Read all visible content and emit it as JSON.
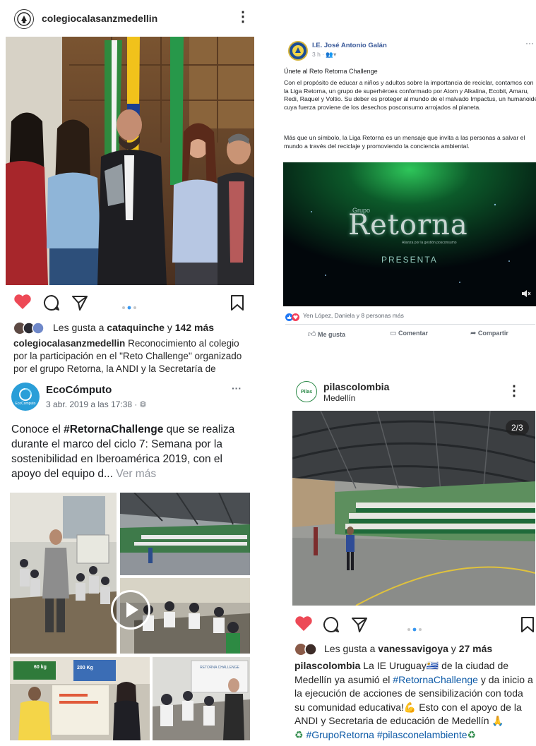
{
  "post1": {
    "username": "colegiocalasanzmedellin",
    "likes_prefix": "Les gusta a ",
    "likes_user": "cataquinche",
    "likes_join": " y ",
    "likes_count": "142 más",
    "caption_user": "colegiocalasanzmedellin",
    "caption_text": " Reconocimiento al colegio por la participación en el \"Reto Challenge\" organizado por el grupo Retorna, la ANDI y la Secretaría de"
  },
  "post2": {
    "page_name": "I.E. José Antonio Galán",
    "time": "3 h · ",
    "title_line": "Únete al Reto Retorna Challenge",
    "paragraph1": "Con el propósito de educar a niños y adultos sobre la importancia de reciclar, contamos con la Liga Retorna, un grupo de superhéroes conformado por Atom y Alkalina, Ecobit, Amaru, Redi, Raquel y Voltio. Su deber es proteger al mundo de el malvado Impactus, un humanoide cuya fuerza proviene de los desechos posconsumo arrojados al planeta.",
    "paragraph2": "Más que un símbolo, la Liga Retorna es un mensaje que invita a las personas a salvar el mundo a través del reciclaje y promoviendo la conciencia ambiental.",
    "video_brand_small": "Grupo",
    "video_brand": "Retorna",
    "video_tagline": "Alianza por la gestión posconsumo",
    "video_presenta": "PRESENTA",
    "reactions_text": "Yen López, Daniela y 8 personas más",
    "like_label": "Me gusta",
    "comment_label": "Comentar",
    "share_label": "Compartir"
  },
  "post3": {
    "page_name": "EcoCómputo",
    "avatar_text": "EcoCómputo",
    "date": "3 abr. 2019 a las 17:38 · ",
    "text_hashtag": "#RetornaChallenge",
    "text_pre": "Conoce el ",
    "text_post": "  que se realiza durante el marco del ciclo 7: Semana por la sostenibilidad en Iberoamérica 2019, con el apoyo del equipo d...",
    "see_more": " Ver más",
    "more_label": "···",
    "sign_60": "60 kg",
    "sign_200": "200 Kg",
    "banner_text": "RETORNA CHALLENGE"
  },
  "post4": {
    "username": "pilascolombia",
    "location": "Medellín",
    "avatar_text": "Pilas",
    "counter": "2/3",
    "likes_prefix": "Les gusta a ",
    "likes_user": "vanessavigoya",
    "likes_join": " y ",
    "likes_count": "27 más",
    "caption_user": "pilascolombia",
    "caption_a": " La IE Uruguay",
    "caption_b": " de la ciudad de Medellín ya asumió el ",
    "caption_hashtag1": "#RetornaChallenge",
    "caption_c": " y da inicio a la ejecución de acciones de sensibilización con toda su comunidad educativa!",
    "caption_d": " Esto con el apoyo de la ANDI y Secretaria de educación de Medellín ",
    "caption_hashtag2": "#GrupoRetorna",
    "caption_hashtag3": "#pilasconelambiente"
  }
}
